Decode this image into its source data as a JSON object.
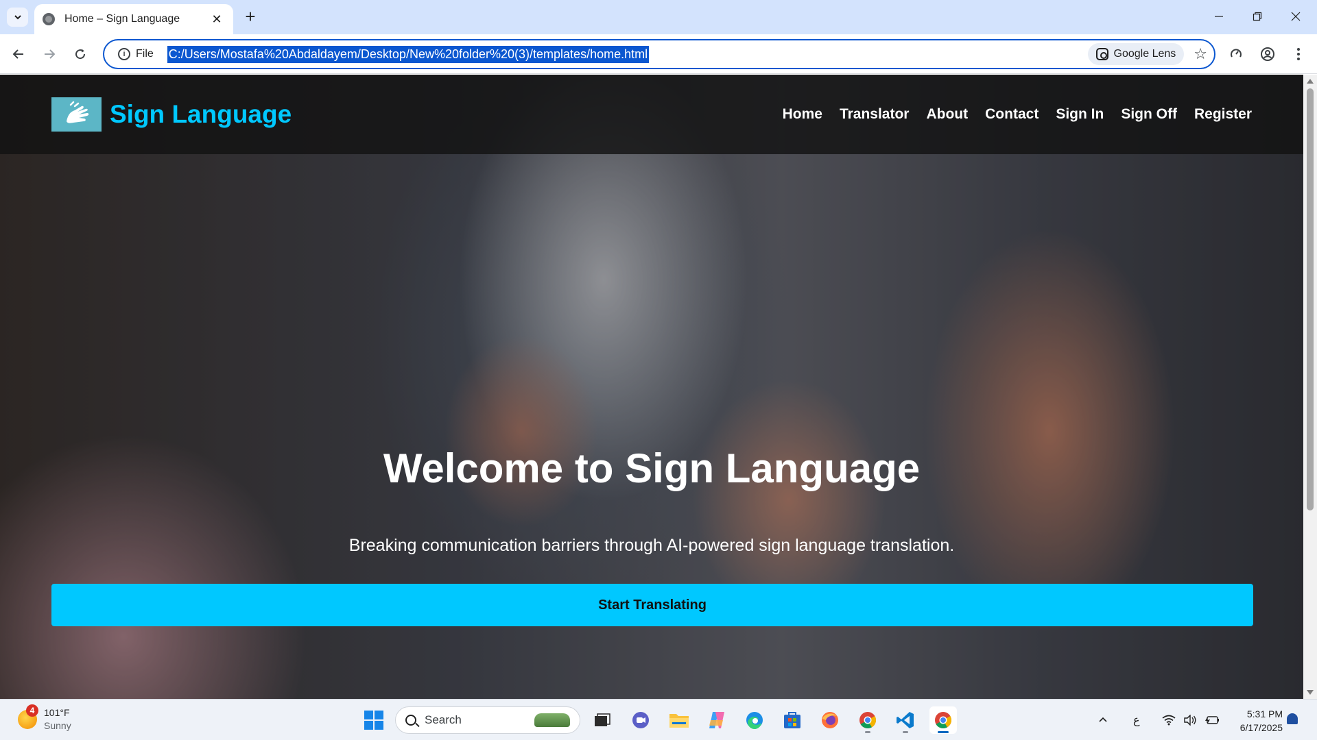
{
  "browser": {
    "tab_title": "Home – Sign Language",
    "tab_close": "✕",
    "new_tab": "+",
    "site_info_label": "File",
    "url": "C:/Users/Mostafa%20Abdaldayem/Desktop/New%20folder%20(3)/templates/home.html",
    "lens_label": "Google Lens"
  },
  "page": {
    "brand": "Sign Language",
    "nav": [
      "Home",
      "Translator",
      "About",
      "Contact",
      "Sign In",
      "Sign Off",
      "Register"
    ],
    "hero_title": "Welcome to Sign Language",
    "hero_subtitle": "Breaking communication barriers through AI-powered sign language translation.",
    "cta_label": "Start Translating",
    "colors": {
      "accent": "#00c8ff",
      "logo_bg": "#5cb6c6",
      "nav_bg": "#121212"
    }
  },
  "taskbar": {
    "weather_temp": "101°F",
    "weather_cond": "Sunny",
    "weather_badge": "4",
    "search_placeholder": "Search",
    "lang_indicator": "ع",
    "time": "5:31 PM",
    "date": "6/17/2025",
    "apps": [
      "start-icon",
      "task-view-icon",
      "teams-icon",
      "file-explorer-icon",
      "copilot-icon",
      "edge-icon",
      "store-icon",
      "firefox-icon",
      "chrome-icon",
      "vscode-icon",
      "chrome-active-icon"
    ]
  }
}
